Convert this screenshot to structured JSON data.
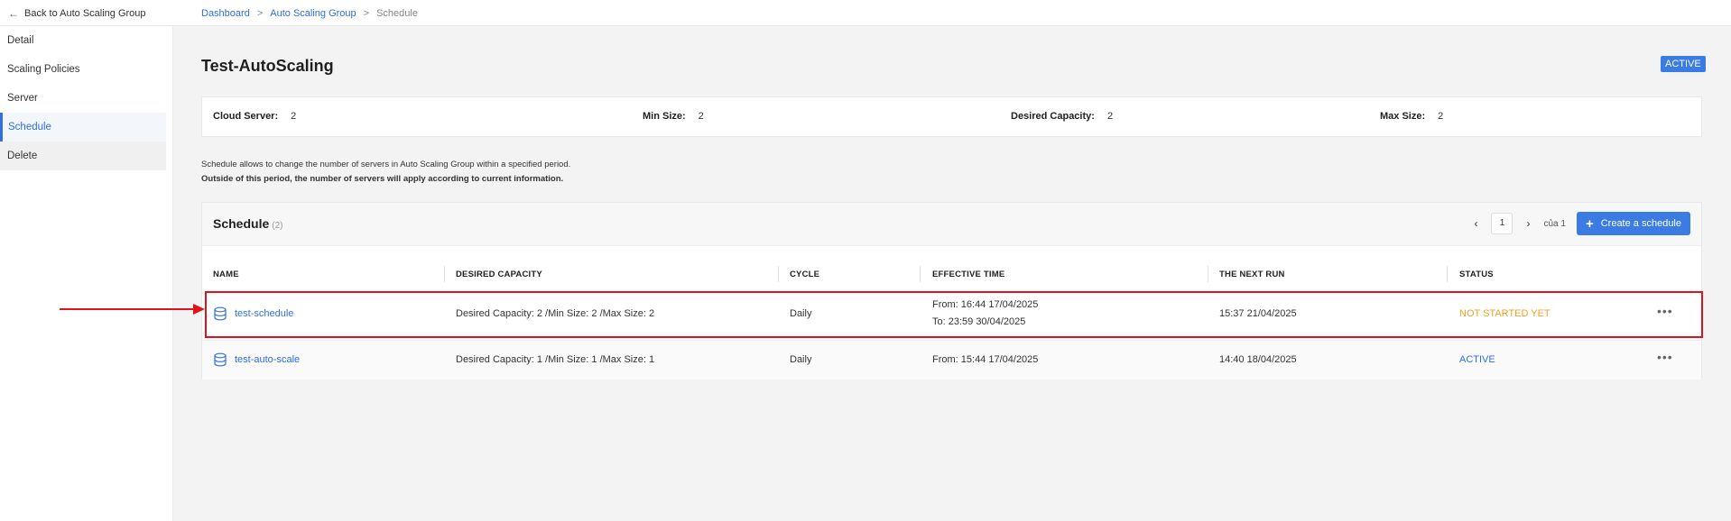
{
  "topbar": {
    "back_label": "Back to Auto Scaling Group",
    "breadcrumb": [
      "Dashboard",
      "Auto Scaling Group",
      "Schedule"
    ]
  },
  "sidebar": {
    "items": [
      {
        "label": "Detail"
      },
      {
        "label": "Scaling Policies"
      },
      {
        "label": "Server"
      },
      {
        "label": "Schedule"
      },
      {
        "label": "Delete"
      }
    ],
    "active": "Schedule"
  },
  "page": {
    "title": "Test-AutoScaling",
    "status": "ACTIVE"
  },
  "info": {
    "cloud_server_label": "Cloud Server:",
    "cloud_server_value": "2",
    "min_size_label": "Min Size:",
    "min_size_value": "2",
    "desired_label": "Desired Capacity:",
    "desired_value": "2",
    "max_size_label": "Max Size:",
    "max_size_value": "2"
  },
  "description": {
    "line1": "Schedule allows to change the number of servers in Auto Scaling Group within a specified period.",
    "line2": "Outside of this period, the number of servers will apply according to current information."
  },
  "schedule": {
    "title": "Schedule",
    "count": "(2)",
    "pager": {
      "prev": "‹",
      "page": "1",
      "next": "›",
      "of_label": "của 1"
    },
    "create_label": "Create a schedule",
    "columns": [
      "NAME",
      "DESIRED CAPACITY",
      "CYCLE",
      "EFFECTIVE TIME",
      "THE NEXT RUN",
      "STATUS"
    ],
    "rows": [
      {
        "name": "test-schedule",
        "capacity": "Desired Capacity: 2 /Min Size: 2 /Max Size: 2",
        "cycle": "Daily",
        "effective_from": "From: 16:44 17/04/2025",
        "effective_to": "To: 23:59 30/04/2025",
        "next_run": "15:37 21/04/2025",
        "status": "NOT STARTED YET",
        "more": "•••"
      },
      {
        "name": "test-auto-scale",
        "capacity": "Desired Capacity: 1 /Min Size: 1 /Max Size: 1",
        "cycle": "Daily",
        "effective_from": "From: 15:44 17/04/2025",
        "next_run": "14:40 18/04/2025",
        "status": "ACTIVE",
        "more": "•••"
      }
    ]
  },
  "colors": {
    "accent": "#3a7be4",
    "link": "#2f6fe0",
    "status_pending": "#f0a020",
    "annotation": "#e0121b"
  }
}
